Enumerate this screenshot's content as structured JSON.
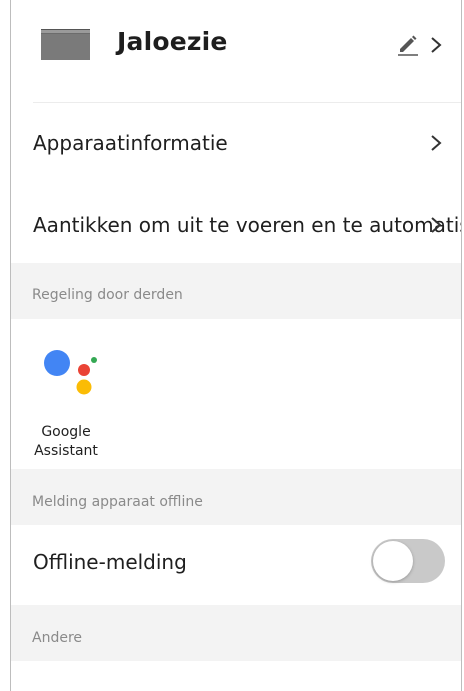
{
  "header": {
    "device_name": "Jaloezie",
    "thumbnail_icon": "roller-blind-icon",
    "edit_icon": "pencil-icon",
    "nav_icon": "chevron-right-icon"
  },
  "rows": {
    "device_info": "Apparaatinformatie",
    "tap_to_run": "Aantikken om uit te voeren en te automatis…"
  },
  "sections": {
    "third_party": "Regeling door derden",
    "offline_notification": "Melding apparaat offline",
    "other": "Andere"
  },
  "third_party": {
    "google_assistant_line1": "Google",
    "google_assistant_line2": "Assistant",
    "logo_colors": [
      "#4285F4",
      "#EA4335",
      "#FBBC05",
      "#34A853"
    ]
  },
  "offline": {
    "label": "Offline-melding",
    "toggle_on": false
  },
  "colors": {
    "section_bg": "#f3f3f3",
    "toggle_off": "#c9c9c9"
  }
}
